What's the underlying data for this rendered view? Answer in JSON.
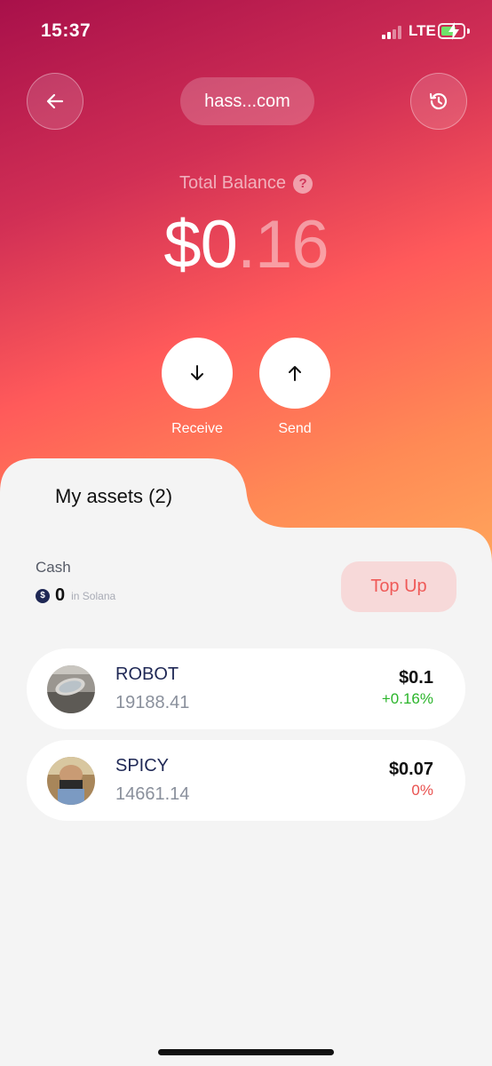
{
  "status_bar": {
    "time": "15:37",
    "network": "LTE"
  },
  "header": {
    "account": "hass...com",
    "back_icon": "arrow-left-icon",
    "history_icon": "history-icon"
  },
  "balance": {
    "label": "Total Balance",
    "help": "?",
    "dollars": "$0",
    "cents": ".16"
  },
  "actions": [
    {
      "label": "Receive",
      "icon": "arrow-down-icon"
    },
    {
      "label": "Send",
      "icon": "arrow-up-icon"
    }
  ],
  "assets_section": {
    "title": "My assets (2)"
  },
  "cash": {
    "label": "Cash",
    "coin_symbol": "$",
    "value": "0",
    "network": "in Solana",
    "topup_label": "Top Up"
  },
  "assets": [
    {
      "name": "ROBOT",
      "amount": "19188.41",
      "value": "$0.1",
      "change": "+0.16%"
    },
    {
      "name": "SPICY",
      "amount": "14661.14",
      "value": "$0.07",
      "change": "0%"
    }
  ],
  "colors": {
    "gradient_start": "#a8104a",
    "gradient_mid": "#ff5a5a",
    "gradient_end": "#ffa65c",
    "topup_bg": "#f7d9d9",
    "topup_text": "#ef5a58",
    "positive": "#2bb52b",
    "neutral_change": "#e9514f"
  }
}
